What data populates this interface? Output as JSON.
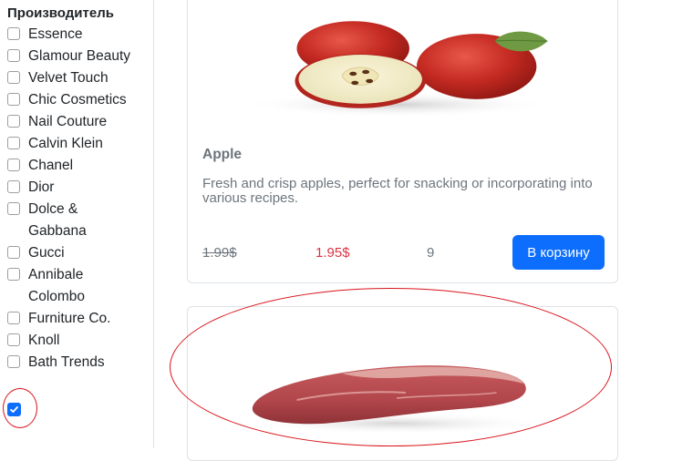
{
  "sidebar": {
    "title": "Производитель",
    "manufacturers": [
      "Essence",
      "Glamour Beauty",
      "Velvet Touch",
      "Chic Cosmetics",
      "Nail Couture",
      "Calvin Klein",
      "Chanel",
      "Dior",
      "Dolce & Gabbana",
      "Gucci",
      "Annibale Colombo",
      "Furniture Co.",
      "Knoll",
      "Bath Trends"
    ],
    "last_checkbox_checked": true
  },
  "products": [
    {
      "image": "apple-image",
      "name": "Apple",
      "description": "Fresh and crisp apples, perfect for snacking or incorporating into various recipes.",
      "old_price": "1.99$",
      "price": "1.95$",
      "quantity": "9",
      "button_label": "В корзину"
    },
    {
      "image": "beef-steak-image"
    }
  ],
  "colors": {
    "primary": "#0d6efd",
    "sale_price": "#dc3545",
    "muted_text": "#6c757d",
    "annotation": "#d9141c"
  }
}
